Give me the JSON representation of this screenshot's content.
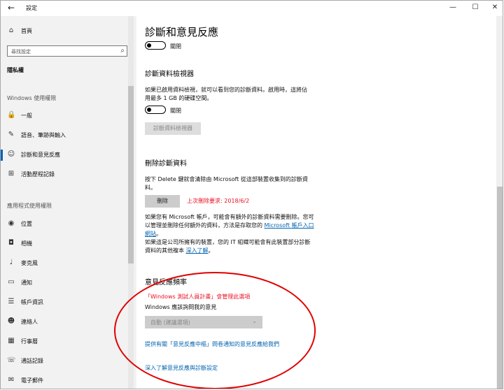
{
  "window": {
    "title": "設定",
    "back_icon": "back-arrow-icon",
    "controls": {
      "minimize": "—",
      "maximize": "☐",
      "close": "✕"
    }
  },
  "sidebar": {
    "home_label": "首頁",
    "search_placeholder": "尋找設定",
    "category": "隱私權",
    "section_windows": "Windows 使用權限",
    "windows_items": [
      {
        "label": "一般",
        "icon": "lock-icon"
      },
      {
        "label": "語音、筆跡與輸入",
        "icon": "pen-icon"
      },
      {
        "label": "診斷和意見反應",
        "icon": "feedback-icon",
        "selected": true
      },
      {
        "label": "活動歷程記錄",
        "icon": "activity-icon"
      }
    ],
    "section_app": "應用程式使用權限",
    "app_items": [
      {
        "label": "位置",
        "icon": "location-icon"
      },
      {
        "label": "相機",
        "icon": "camera-icon"
      },
      {
        "label": "麥克風",
        "icon": "microphone-icon"
      },
      {
        "label": "通知",
        "icon": "notification-icon"
      },
      {
        "label": "帳戶資訊",
        "icon": "account-icon"
      },
      {
        "label": "連絡人",
        "icon": "contacts-icon"
      },
      {
        "label": "行事曆",
        "icon": "calendar-icon"
      },
      {
        "label": "通話記錄",
        "icon": "call-history-icon"
      },
      {
        "label": "電子郵件",
        "icon": "email-icon"
      }
    ]
  },
  "main": {
    "page_title": "診斷和意見反應",
    "top_toggle_state": "關閉",
    "viewer_heading": "診斷資料檢視器",
    "viewer_desc_1": "如果已啟用資料檢視，就可以看到您的診斷資料。啟用時，這將佔",
    "viewer_desc_2": "用最多 1 GB 的硬碟空間。",
    "viewer_toggle_state": "關閉",
    "viewer_button": "診斷資料檢視器",
    "delete_heading": "刪除診斷資料",
    "delete_desc_1": "按下 Delete 鍵就會清除由 Microsoft 從這部裝置收集到的診斷資",
    "delete_desc_2": "料。",
    "delete_button": "刪除",
    "last_delete": "上次刪除要求: 2018/6/2",
    "ms_account_1": "如果您有 Microsoft 帳戶，可能會有額外的診斷資料需要刪除。您可",
    "ms_account_2": "以管理並刪除任何額外的資料，方法是存取您的",
    "ms_account_link_1": "Microsoft 帳戶入口",
    "ms_account_link_2": "網站",
    "ms_account_end": "。",
    "company_1": "如果這是公司所擁有的裝置，您的 IT 組織可能會有此裝置部分診斷",
    "company_2": "資料的其他複本",
    "company_link": "深入了解",
    "company_end": "。",
    "feedback_heading": "意見反應頻率",
    "insider_notice": "「Windows 測試人員計畫」會管理此選項",
    "ask_label": "Windows 應該詢問我的意見",
    "frequency_value": "自動 (建議選項)",
    "feedback_hub_link": "提供有關「意見反應中樞」問卷通知的意見反應給我們",
    "learn_more_link": "深入了解意見反應與診斷設定"
  },
  "annotation_color": "#e00000",
  "accent_color": "#0063b1"
}
